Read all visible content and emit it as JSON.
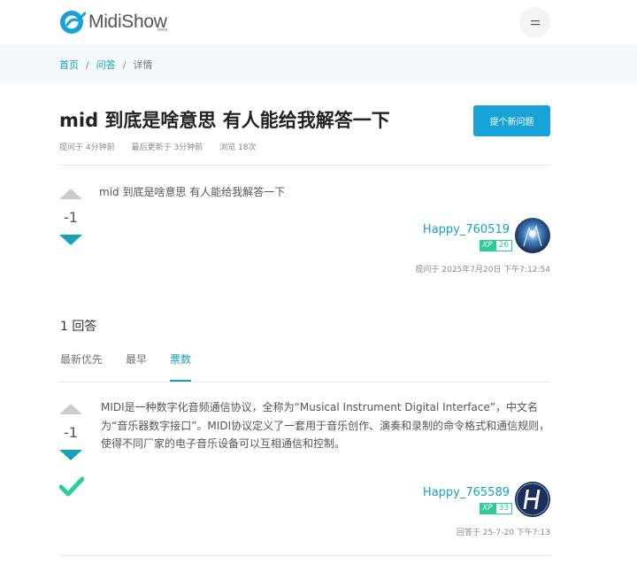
{
  "header": {
    "logo_text": "MidiShow",
    "logo_badge": "beta",
    "menu_icon": "hamburger-icon"
  },
  "breadcrumb": {
    "home": "首页",
    "questions": "问答",
    "current": "详情"
  },
  "question": {
    "title": "mid 到底是啥意思 有人能给我解答一下",
    "asked": "提问于 4分钟前",
    "updated": "最后更新于 3分钟前",
    "views": "浏览 18次",
    "ask_button": "提个新问题",
    "votes": "-1",
    "body": "mid 到底是啥意思 有人能给我解答一下",
    "user": {
      "name": "Happy_760519",
      "xp_label": "XP",
      "xp": "26",
      "timestamp": "提问于 2025年7月20日 下午7:12:54"
    }
  },
  "answers": {
    "count_label": "1 回答",
    "tabs": [
      "最新优先",
      "最早",
      "票数"
    ],
    "active_tab": "票数",
    "items": [
      {
        "votes": "-1",
        "body": "MIDI是一种数字化音频通信协议，全称为“Musical Instrument Digital Interface”，中文名为“音乐器数字接口”。MIDI协议定义了一套用于音乐创作、演奏和录制的命令格式和通信规则，使得不同厂家的电子音乐设备可以互相通信和控制。",
        "accepted_icon": "checkmark-icon",
        "user": {
          "name": "Happy_765589",
          "xp_label": "XP",
          "xp": "33",
          "timestamp": "回答于 25-7-20 下午7:13"
        }
      }
    ]
  },
  "colors": {
    "accent": "#17a2b8",
    "button": "#17a2d8",
    "xp_green": "#2ecc9a",
    "crumb_bg": "#f3f8fc"
  }
}
